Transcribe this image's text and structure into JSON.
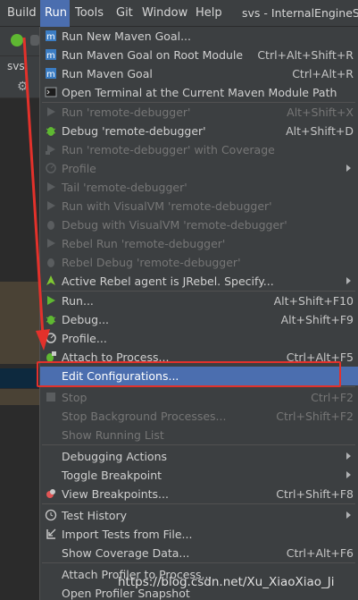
{
  "menubar": {
    "items": [
      "Build",
      "Run",
      "Tools",
      "Git",
      "Window",
      "Help"
    ],
    "title": "svs - InternalEngineSe"
  },
  "left_panel": {
    "tab": "svs"
  },
  "run_menu": {
    "items": [
      {
        "label": "Run New Maven Goal...",
        "shortcut": "",
        "enabled": true,
        "icon": "maven-icon"
      },
      {
        "label": "Run Maven Goal on Root Module",
        "shortcut": "Ctrl+Alt+Shift+R",
        "enabled": true,
        "icon": "maven-icon"
      },
      {
        "label": "Run Maven Goal",
        "shortcut": "Ctrl+Alt+R",
        "enabled": true,
        "icon": "maven-icon"
      },
      {
        "label": "Open Terminal at the Current Maven Module Path",
        "shortcut": "",
        "enabled": true,
        "icon": "terminal-icon"
      },
      {
        "label": "Run 'remote-debugger'",
        "shortcut": "Alt+Shift+X",
        "enabled": false,
        "icon": "run-icon"
      },
      {
        "label": "Debug 'remote-debugger'",
        "shortcut": "Alt+Shift+D",
        "enabled": true,
        "icon": "debug-icon"
      },
      {
        "label": "Run 'remote-debugger' with Coverage",
        "shortcut": "",
        "enabled": false,
        "icon": "coverage-icon"
      },
      {
        "label": "Profile",
        "shortcut": "",
        "enabled": false,
        "icon": "profile-icon",
        "submenu": true
      },
      {
        "label": "Tail 'remote-debugger'",
        "shortcut": "",
        "enabled": false,
        "icon": "tail-icon"
      },
      {
        "label": "Run with VisualVM 'remote-debugger'",
        "shortcut": "",
        "enabled": false,
        "icon": "visualvm-icon"
      },
      {
        "label": "Debug with VisualVM 'remote-debugger'",
        "shortcut": "",
        "enabled": false,
        "icon": "visualvm-debug-icon"
      },
      {
        "label": "Rebel Run 'remote-debugger'",
        "shortcut": "",
        "enabled": false,
        "icon": "jrebel-run-icon"
      },
      {
        "label": "Rebel Debug 'remote-debugger'",
        "shortcut": "",
        "enabled": false,
        "icon": "jrebel-debug-icon"
      },
      {
        "label": "Active Rebel agent is JRebel. Specify...",
        "shortcut": "",
        "enabled": true,
        "icon": "jrebel-icon"
      },
      {
        "label": "Run...",
        "shortcut": "Alt+Shift+F10",
        "enabled": true,
        "icon": "run-icon"
      },
      {
        "label": "Debug...",
        "shortcut": "Alt+Shift+F9",
        "enabled": true,
        "icon": "debug-icon"
      },
      {
        "label": "Profile...",
        "shortcut": "",
        "enabled": true,
        "icon": "profile-icon"
      },
      {
        "label": "Attach to Process...",
        "shortcut": "Ctrl+Alt+F5",
        "enabled": true,
        "icon": "attach-icon"
      },
      {
        "label": "Edit Configurations...",
        "shortcut": "",
        "enabled": true,
        "icon": "",
        "highlighted": true
      },
      {
        "label": "Stop",
        "shortcut": "Ctrl+F2",
        "enabled": false,
        "icon": "stop-icon"
      },
      {
        "label": "Stop Background Processes...",
        "shortcut": "Ctrl+Shift+F2",
        "enabled": false,
        "icon": ""
      },
      {
        "label": "Show Running List",
        "shortcut": "",
        "enabled": false,
        "icon": ""
      },
      {
        "label": "Debugging Actions",
        "shortcut": "",
        "enabled": true,
        "icon": "",
        "submenu": true
      },
      {
        "label": "Toggle Breakpoint",
        "shortcut": "",
        "enabled": true,
        "icon": "",
        "submenu": true
      },
      {
        "label": "View Breakpoints...",
        "shortcut": "Ctrl+Shift+F8",
        "enabled": true,
        "icon": "breakpoints-icon"
      },
      {
        "label": "Test History",
        "shortcut": "",
        "enabled": true,
        "icon": "history-icon",
        "submenu": true
      },
      {
        "label": "Import Tests from File...",
        "shortcut": "",
        "enabled": true,
        "icon": "import-icon"
      },
      {
        "label": "Show Coverage Data...",
        "shortcut": "Ctrl+Alt+F6",
        "enabled": true,
        "icon": ""
      },
      {
        "label": "Attach Profiler to Process...",
        "shortcut": "",
        "enabled": true,
        "icon": ""
      },
      {
        "label": "Open Profiler Snapshot",
        "shortcut": "",
        "enabled": true,
        "icon": ""
      }
    ]
  },
  "watermark": "https://blog.csdn.net/Xu_XiaoXiao_Ji",
  "colors": {
    "menu_bg": "#3c3f41",
    "highlight": "#4b6eaf",
    "annotation_red": "#e3312b"
  }
}
